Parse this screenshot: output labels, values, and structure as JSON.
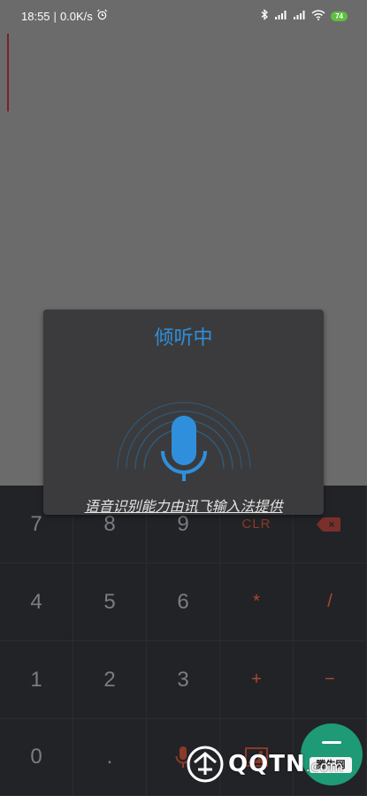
{
  "status_bar": {
    "time": "18:55",
    "separator": "|",
    "net_speed": "0.0K/s",
    "battery": "74"
  },
  "dialog": {
    "title": "倾听中",
    "provider_text": "语音识别能力由讯飞输入法提供"
  },
  "keypad": {
    "keys": [
      "7",
      "8",
      "9",
      "CLR",
      "4",
      "5",
      "6",
      "*",
      "/",
      "1",
      "2",
      "3",
      "+",
      "−",
      "0",
      "."
    ]
  },
  "fab": {
    "label": "腾牛网"
  },
  "watermark": {
    "text": "QQTN",
    "suffix": ".com"
  },
  "colors": {
    "accent": "#2f8fdc",
    "operator": "#a84a2c",
    "fab": "#1f9a76"
  }
}
